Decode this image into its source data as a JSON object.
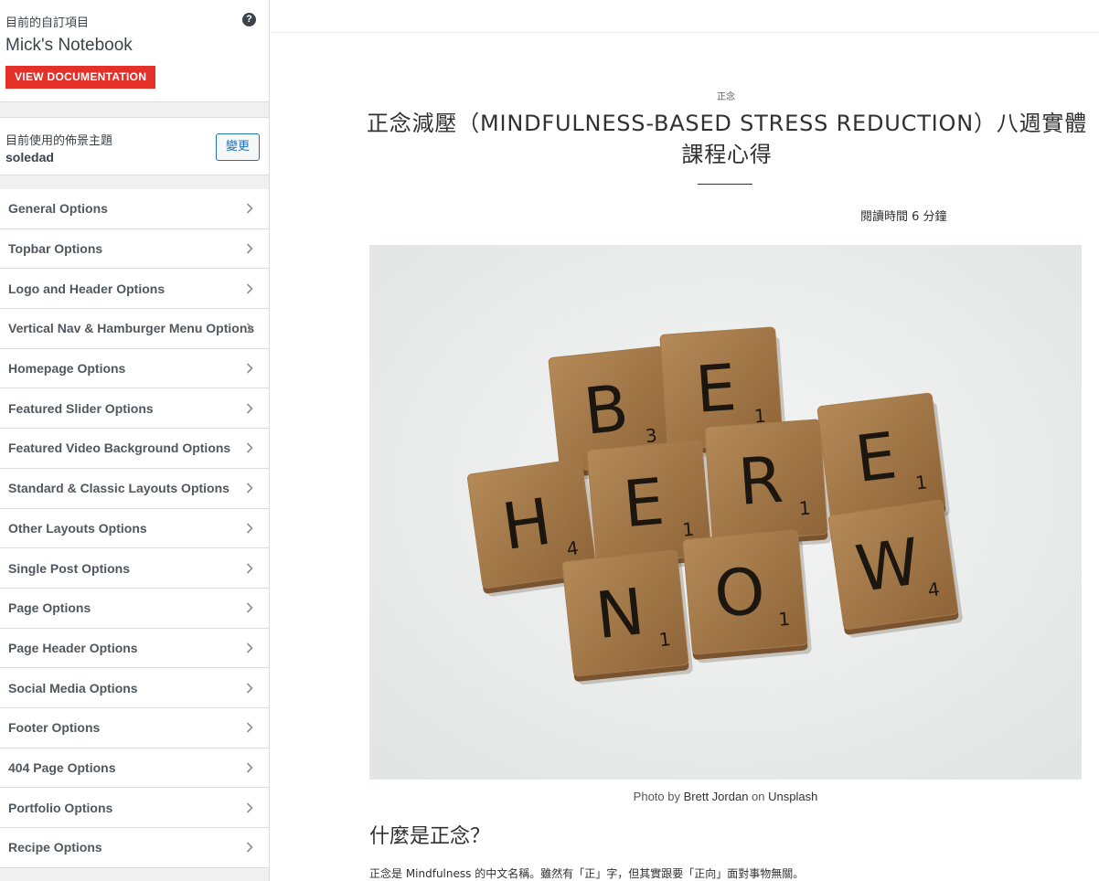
{
  "sidebar": {
    "customizing_label": "目前的自訂項目",
    "site_title": "Mick's Notebook",
    "docs_button": "VIEW DOCUMENTATION",
    "help_icon": "help-circle-icon",
    "theme_label": "目前使用的佈景主題",
    "theme_name": "soledad",
    "change_button": "變更",
    "panels": [
      {
        "label": "General Options"
      },
      {
        "label": "Topbar Options"
      },
      {
        "label": "Logo and Header Options"
      },
      {
        "label": "Vertical Nav & Hamburger Menu Options"
      },
      {
        "label": "Homepage Options"
      },
      {
        "label": "Featured Slider Options"
      },
      {
        "label": "Featured Video Background Options"
      },
      {
        "label": "Standard & Classic Layouts Options"
      },
      {
        "label": "Other Layouts Options"
      },
      {
        "label": "Single Post Options"
      },
      {
        "label": "Page Options"
      },
      {
        "label": "Page Header Options"
      },
      {
        "label": "Social Media Options"
      },
      {
        "label": "Footer Options"
      },
      {
        "label": "404 Page Options"
      },
      {
        "label": "Portfolio Options"
      },
      {
        "label": "Recipe Options"
      }
    ]
  },
  "post": {
    "category": "正念",
    "title": "正念減壓（MINDFULNESS-BASED STRESS REDUCTION）八週實體課程心得",
    "reading_time": "閱讀時間 6 分鐘",
    "image_tiles": [
      "B",
      "E",
      "H",
      "E",
      "R",
      "E",
      "N",
      "O",
      "W"
    ],
    "caption": {
      "prefix": "Photo by ",
      "author": "Brett Jordan",
      "middle": " on ",
      "source": "Unsplash"
    },
    "section_heading": "什麼是正念？",
    "paragraph": "正念是 Mindfulness 的中文名稱。雖然有「正」字，但其實跟要「正向」面對事物無關。"
  },
  "colors": {
    "accent_red": "#e5302a",
    "link_blue": "#2271b1",
    "tile_wood": "#a57a4b"
  }
}
